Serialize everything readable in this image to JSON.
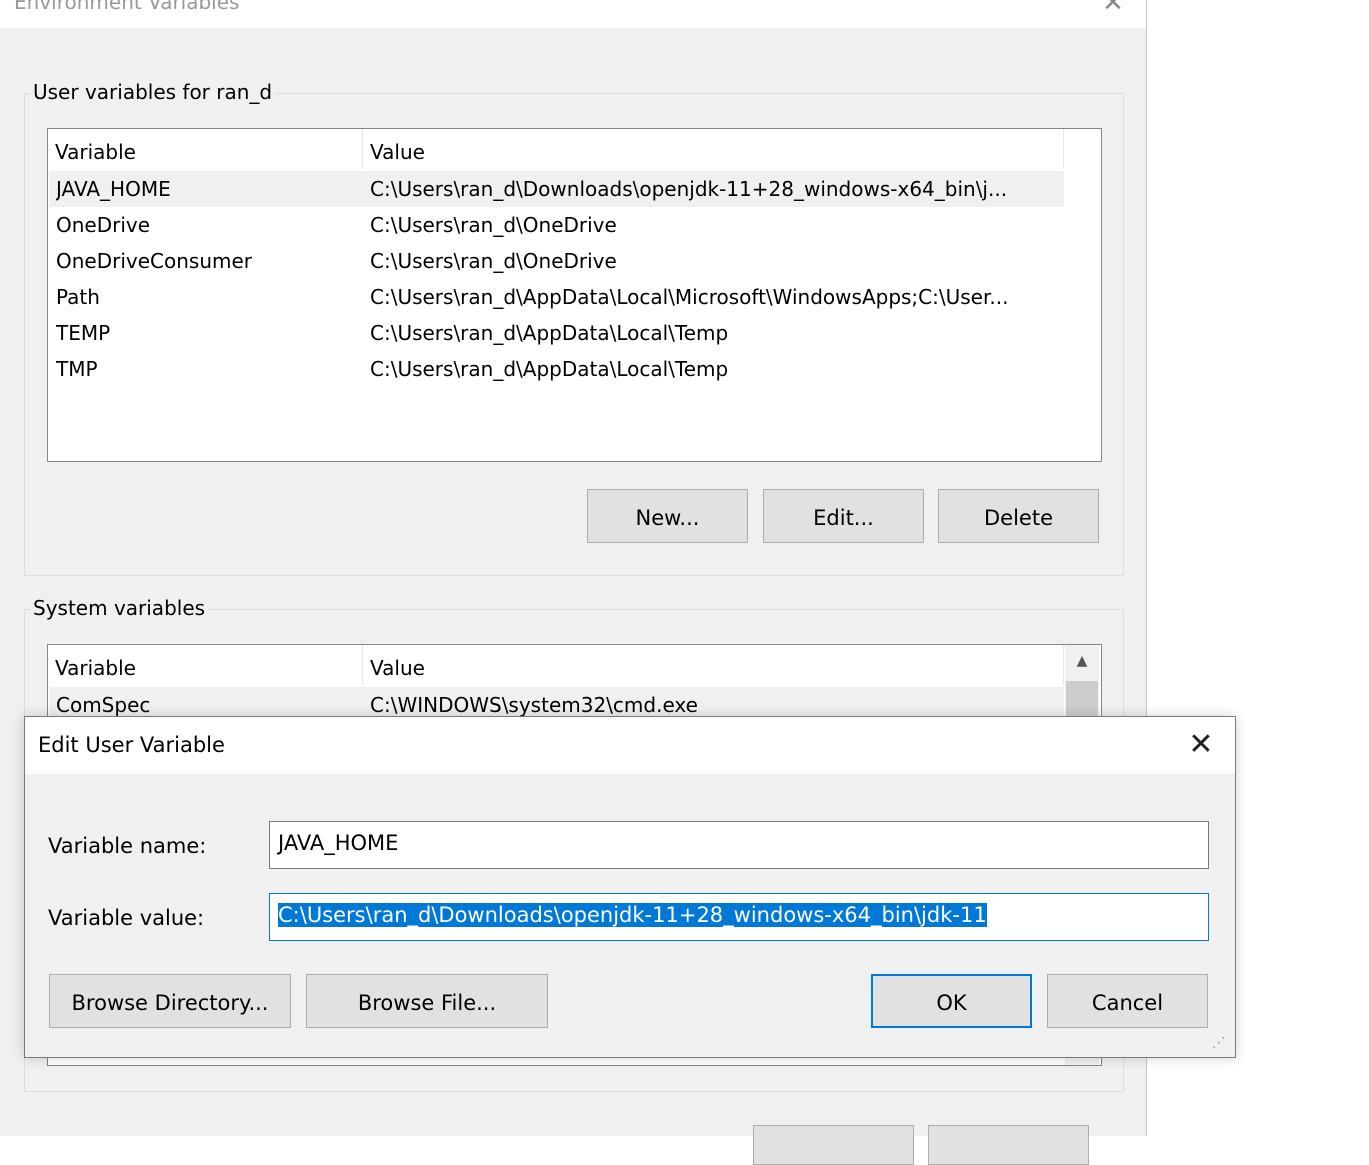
{
  "env_window": {
    "title": "Environment Variables",
    "user_group": {
      "label": "User variables for ran_d",
      "columns": [
        "Variable",
        "Value"
      ],
      "rows": [
        {
          "variable": "JAVA_HOME",
          "value": "C:\\Users\\ran_d\\Downloads\\openjdk-11+28_windows-x64_bin\\j..."
        },
        {
          "variable": "OneDrive",
          "value": "C:\\Users\\ran_d\\OneDrive"
        },
        {
          "variable": "OneDriveConsumer",
          "value": "C:\\Users\\ran_d\\OneDrive"
        },
        {
          "variable": "Path",
          "value": "C:\\Users\\ran_d\\AppData\\Local\\Microsoft\\WindowsApps;C:\\User..."
        },
        {
          "variable": "TEMP",
          "value": "C:\\Users\\ran_d\\AppData\\Local\\Temp"
        },
        {
          "variable": "TMP",
          "value": "C:\\Users\\ran_d\\AppData\\Local\\Temp"
        }
      ],
      "buttons": {
        "new": "New...",
        "edit": "Edit...",
        "delete": "Delete"
      }
    },
    "system_group": {
      "label": "System variables",
      "columns": [
        "Variable",
        "Value"
      ],
      "rows": [
        {
          "variable": "ComSpec",
          "value": "C:\\WINDOWS\\system32\\cmd.exe"
        }
      ]
    }
  },
  "edit_dialog": {
    "title": "Edit User Variable",
    "name_label": "Variable name:",
    "name_value": "JAVA_HOME",
    "value_label": "Variable value:",
    "value_value": "C:\\Users\\ran_d\\Downloads\\openjdk-11+28_windows-x64_bin\\jdk-11",
    "buttons": {
      "browse_directory": "Browse Directory...",
      "browse_file": "Browse File...",
      "ok": "OK",
      "cancel": "Cancel"
    }
  },
  "colors": {
    "accent": "#0078d7",
    "window_bg": "#f0f0f0",
    "button_bg": "#e1e1e1"
  },
  "icons": {
    "close": "close-icon",
    "scroll_up": "chevron-up-icon",
    "resize_grip": "resize-grip-icon"
  }
}
